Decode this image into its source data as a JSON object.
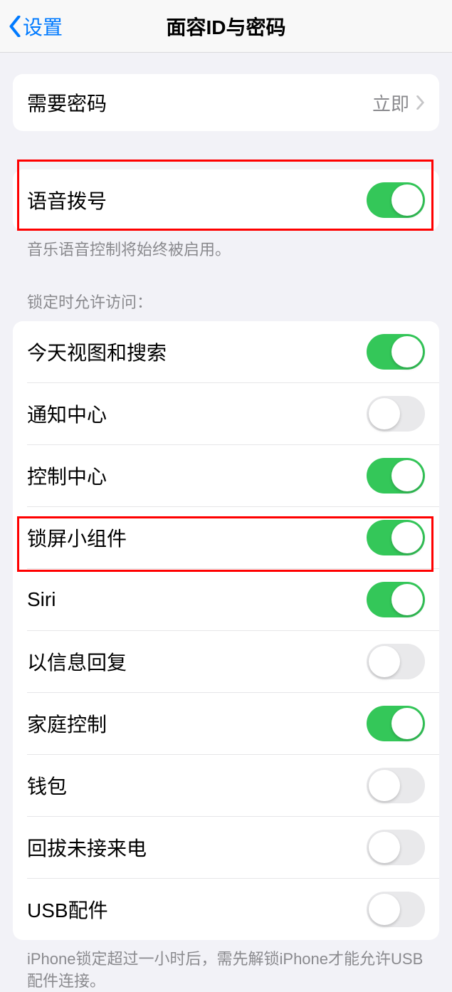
{
  "nav": {
    "back": "设置",
    "title": "面容ID与密码"
  },
  "passcode_row": {
    "label": "需要密码",
    "value": "立即"
  },
  "voice_dial": {
    "label": "语音拨号",
    "on": true,
    "footer": "音乐语音控制将始终被启用。"
  },
  "lock_access_header": "锁定时允许访问：",
  "lock_access": [
    {
      "label": "今天视图和搜索",
      "on": true
    },
    {
      "label": "通知中心",
      "on": false
    },
    {
      "label": "控制中心",
      "on": true
    },
    {
      "label": "锁屏小组件",
      "on": true
    },
    {
      "label": "Siri",
      "on": true
    },
    {
      "label": "以信息回复",
      "on": false
    },
    {
      "label": "家庭控制",
      "on": true
    },
    {
      "label": "钱包",
      "on": false
    },
    {
      "label": "回拔未接来电",
      "on": false
    },
    {
      "label": "USB配件",
      "on": false
    }
  ],
  "usb_footer": "iPhone锁定超过一小时后，需先解锁iPhone才能允许USB配件连接。"
}
